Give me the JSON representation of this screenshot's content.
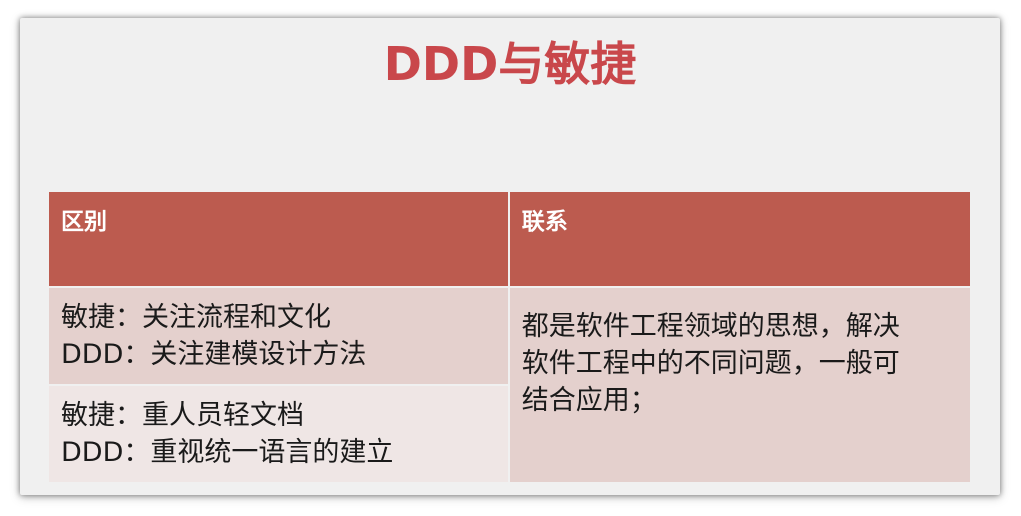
{
  "slide": {
    "title": "DDD与敏捷"
  },
  "table": {
    "headers": [
      "区别",
      "联系"
    ],
    "differences": [
      [
        "敏捷：关注流程和文化",
        "DDD：关注建模设计方法"
      ],
      [
        "敏捷：重人员轻文档",
        "DDD：重视统一语言的建立"
      ]
    ],
    "relation_lines": [
      "都是软件工程领域的思想，解决",
      "软件工程中的不同问题，一般可",
      "结合应用；"
    ]
  },
  "colors": {
    "title": "#c9474b",
    "header_bg": "#bc5b4f",
    "row_odd_bg": "#e4d0cd",
    "row_even_bg": "#efe6e5",
    "slide_bg": "#f0f0f0"
  }
}
